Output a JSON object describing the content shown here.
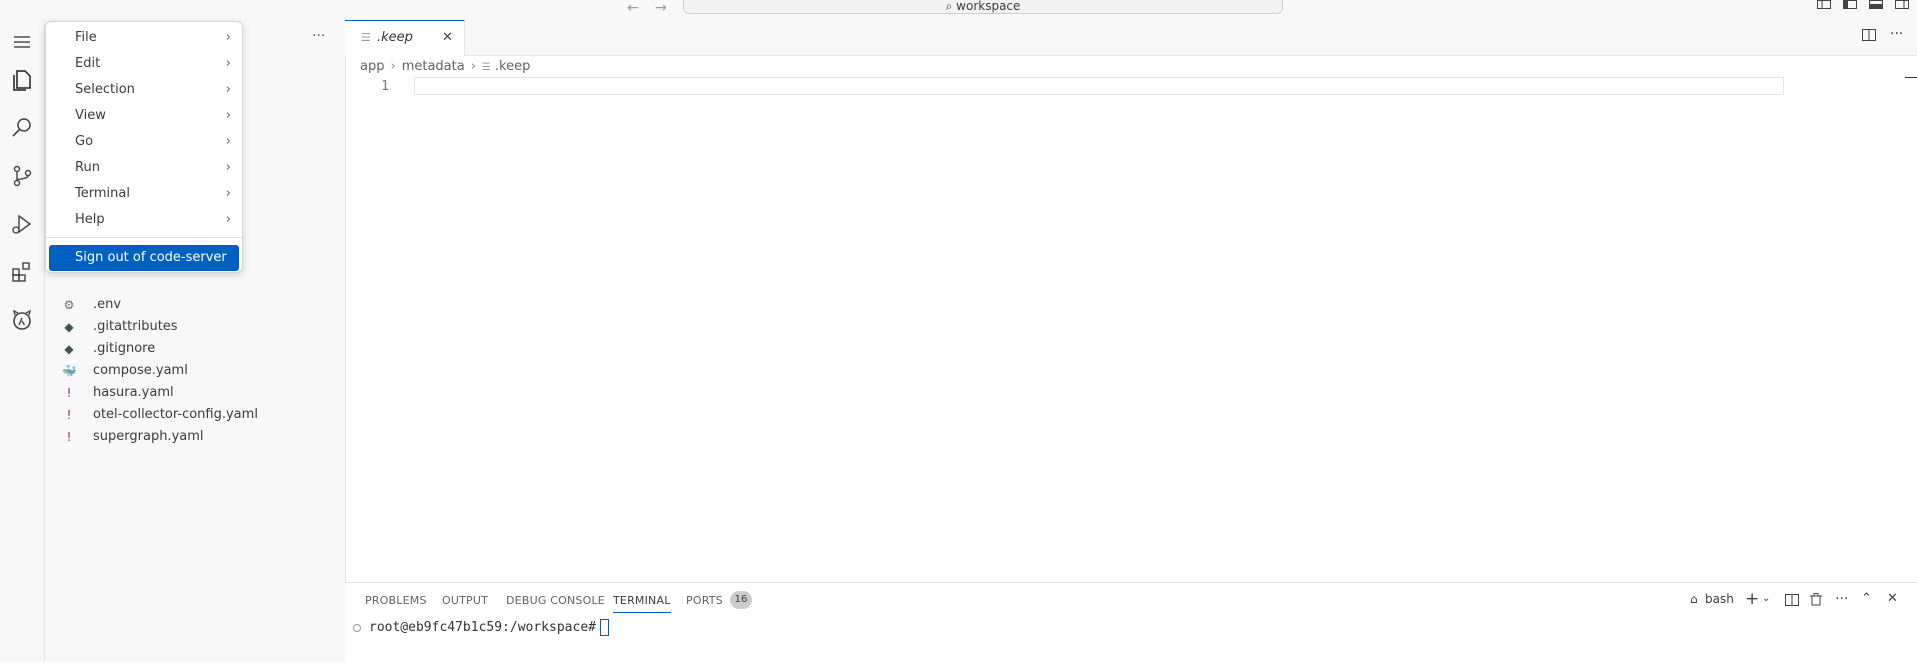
{
  "titlebar": {
    "search_text": "workspace",
    "back_icon": "arrow-left-icon",
    "forward_icon": "arrow-right-icon"
  },
  "menu": {
    "items": [
      {
        "label": "File"
      },
      {
        "label": "Edit"
      },
      {
        "label": "Selection"
      },
      {
        "label": "View"
      },
      {
        "label": "Go"
      },
      {
        "label": "Run"
      },
      {
        "label": "Terminal"
      },
      {
        "label": "Help"
      }
    ],
    "signout_label": "Sign out of code-server"
  },
  "explorer": {
    "files": [
      {
        "name": ".env",
        "icon": "gear-icon",
        "glyph": "⚙",
        "color": "#6d6d6d"
      },
      {
        "name": ".gitattributes",
        "icon": "git-icon",
        "glyph": "◆",
        "color": "#41535b"
      },
      {
        "name": ".gitignore",
        "icon": "git-icon",
        "glyph": "◆",
        "color": "#41535b"
      },
      {
        "name": "compose.yaml",
        "icon": "docker-icon",
        "glyph": "🐳",
        "color": "#e0446a"
      },
      {
        "name": "hasura.yaml",
        "icon": "yaml-icon",
        "glyph": "!",
        "color": "#a0226a"
      },
      {
        "name": "otel-collector-config.yaml",
        "icon": "yaml-icon",
        "glyph": "!",
        "color": "#a0226a"
      },
      {
        "name": "supergraph.yaml",
        "icon": "yaml-icon",
        "glyph": "!",
        "color": "#a0226a"
      }
    ]
  },
  "editor": {
    "tab_label": ".keep",
    "breadcrumb": [
      "app",
      "metadata",
      ".keep"
    ],
    "line_number": "1"
  },
  "panel": {
    "tabs": [
      "PROBLEMS",
      "OUTPUT",
      "DEBUG CONSOLE",
      "TERMINAL",
      "PORTS"
    ],
    "ports_count": "16",
    "terminal_name": "bash",
    "prompt": "root@eb9fc47b1c59:/workspace#"
  },
  "colors": {
    "accent": "#005fb8",
    "menu_highlight": "#0060c0"
  }
}
